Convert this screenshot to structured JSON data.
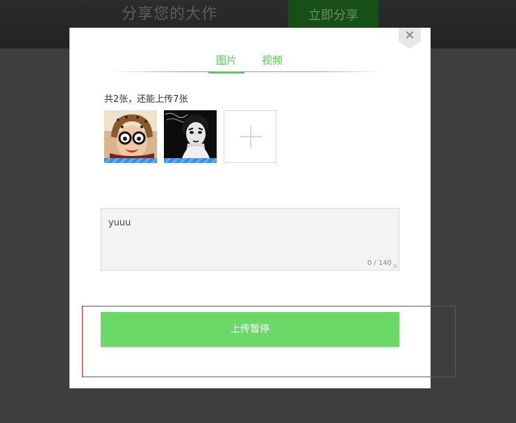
{
  "background": {
    "title": "分享您的大作",
    "share_button": "立即分享"
  },
  "modal": {
    "close_symbol": "×",
    "tabs": [
      {
        "label": "图片",
        "active": true
      },
      {
        "label": "视频",
        "active": false
      }
    ],
    "count_text": "共2张，还能上传7张",
    "thumbnails": [
      {
        "icon": "photo-girl-leopard-hat"
      },
      {
        "icon": "photo-woman-portrait-bw"
      }
    ],
    "textarea": {
      "value": "yuuu",
      "counter": "0 / 140"
    },
    "upload_button": "上传暂停"
  },
  "colors": {
    "accent": "#5ec65a",
    "button": "#6ad968",
    "highlight": "#d22b2b",
    "overlay": "#3e3e3e"
  }
}
